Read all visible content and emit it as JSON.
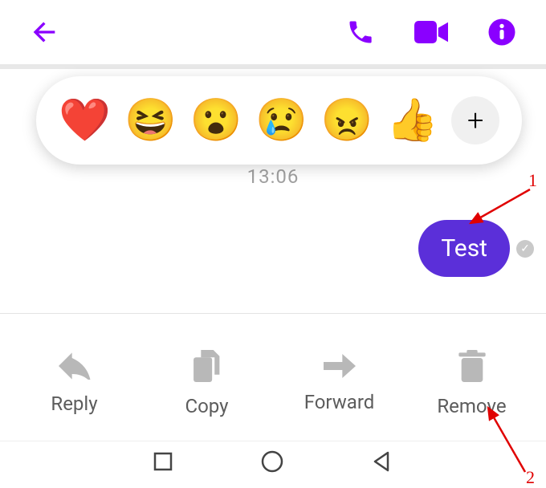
{
  "header": {
    "back_icon": "back-arrow",
    "call_icon": "phone",
    "video_icon": "video",
    "info_icon": "info"
  },
  "reactions": {
    "emojis": [
      "❤️",
      "😆",
      "😮",
      "😢",
      "😠",
      "👍"
    ],
    "plus_label": "+"
  },
  "chat": {
    "timestamp": "13:06",
    "message_text": "Test"
  },
  "actions": {
    "reply": "Reply",
    "copy": "Copy",
    "forward": "Forward",
    "remove": "Remove"
  },
  "annotations": {
    "label1": "1",
    "label2": "2"
  }
}
